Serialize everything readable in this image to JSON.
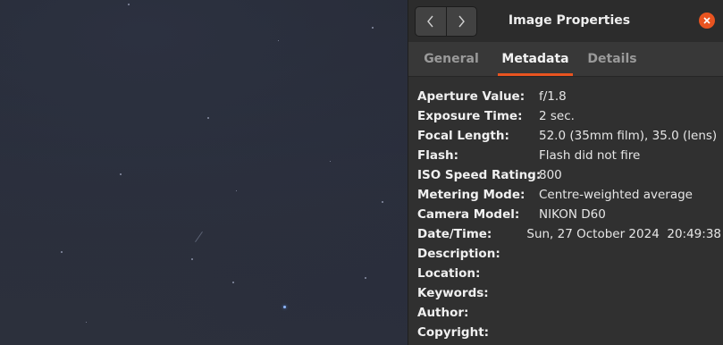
{
  "window": {
    "title": "Image Properties",
    "nav": {
      "back_icon": "chevron-left-icon",
      "forward_icon": "chevron-right-icon"
    },
    "close_icon": "close-icon",
    "accent_color": "#e95420"
  },
  "tabs": [
    {
      "label": "General",
      "active": false
    },
    {
      "label": "Metadata",
      "active": true
    },
    {
      "label": "Details",
      "active": false
    }
  ],
  "metadata": [
    {
      "label": "Aperture Value:",
      "value": "f/1.8"
    },
    {
      "label": "Exposure Time:",
      "value": "2 sec."
    },
    {
      "label": "Focal Length:",
      "value": "52.0 (35mm film), 35.0 (lens)"
    },
    {
      "label": "Flash:",
      "value": "Flash did not fire"
    },
    {
      "label": "ISO Speed Rating:",
      "value": "800"
    },
    {
      "label": "Metering Mode:",
      "value": "Centre-weighted average"
    },
    {
      "label": "Camera Model:",
      "value": "NIKON D60"
    },
    {
      "label": "Date/Time:",
      "value": "Sun, 27 October 2024  20:49:38"
    },
    {
      "label": "Description:",
      "value": ""
    },
    {
      "label": "Location:",
      "value": ""
    },
    {
      "label": "Keywords:",
      "value": ""
    },
    {
      "label": "Author:",
      "value": ""
    },
    {
      "label": "Copyright:",
      "value": ""
    }
  ]
}
